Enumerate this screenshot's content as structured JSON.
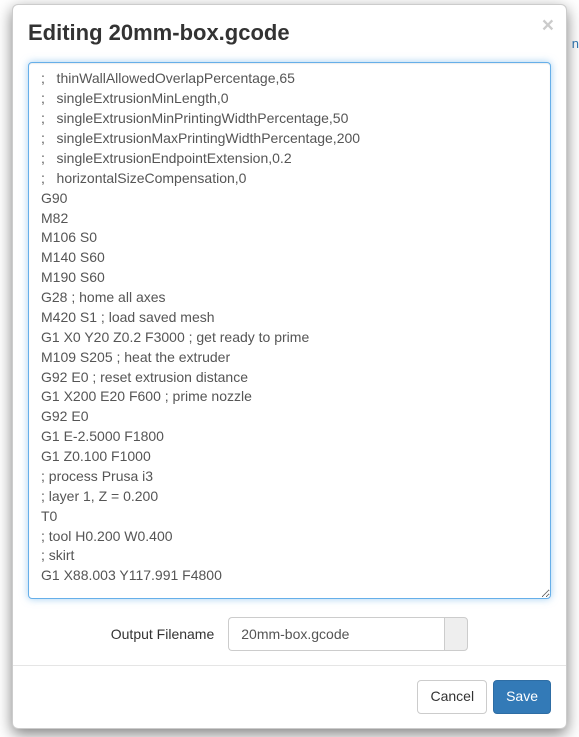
{
  "modal": {
    "title": "Editing 20mm-box.gcode",
    "close_label": "×"
  },
  "editor": {
    "content": ";   thinWallAllowedOverlapPercentage,65\n;   singleExtrusionMinLength,0\n;   singleExtrusionMinPrintingWidthPercentage,50\n;   singleExtrusionMaxPrintingWidthPercentage,200\n;   singleExtrusionEndpointExtension,0.2\n;   horizontalSizeCompensation,0\nG90\nM82\nM106 S0\nM140 S60\nM190 S60\nG28 ; home all axes\nM420 S1 ; load saved mesh\nG1 X0 Y20 Z0.2 F3000 ; get ready to prime\nM109 S205 ; heat the extruder\nG92 E0 ; reset extrusion distance\nG1 X200 E20 F600 ; prime nozzle\nG92 E0\nG1 E-2.5000 F1800\nG1 Z0.100 F1000\n; process Prusa i3\n; layer 1, Z = 0.200\nT0\n; tool H0.200 W0.400\n; skirt\nG1 X88.003 Y117.991 F4800"
  },
  "filename": {
    "label": "Output Filename",
    "value": "20mm-box.gcode"
  },
  "footer": {
    "cancel_label": "Cancel",
    "save_label": "Save"
  },
  "behind": {
    "hint_text": "n"
  }
}
